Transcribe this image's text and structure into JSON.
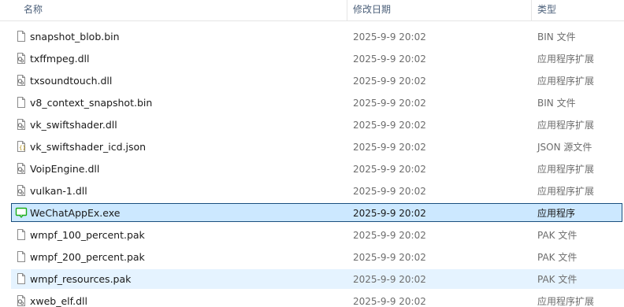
{
  "columns": {
    "name": "名称",
    "date": "修改日期",
    "type": "类型"
  },
  "files": [
    {
      "name": "snapshot_blob.bin",
      "date": "2025-9-9 20:02",
      "type": "BIN 文件",
      "icon": "file-icon",
      "state": ""
    },
    {
      "name": "txffmpeg.dll",
      "date": "2025-9-9 20:02",
      "type": "应用程序扩展",
      "icon": "dll-icon",
      "state": ""
    },
    {
      "name": "txsoundtouch.dll",
      "date": "2025-9-9 20:02",
      "type": "应用程序扩展",
      "icon": "dll-icon",
      "state": ""
    },
    {
      "name": "v8_context_snapshot.bin",
      "date": "2025-9-9 20:02",
      "type": "BIN 文件",
      "icon": "file-icon",
      "state": ""
    },
    {
      "name": "vk_swiftshader.dll",
      "date": "2025-9-9 20:02",
      "type": "应用程序扩展",
      "icon": "dll-icon",
      "state": ""
    },
    {
      "name": "vk_swiftshader_icd.json",
      "date": "2025-9-9 20:02",
      "type": "JSON 源文件",
      "icon": "json-icon",
      "state": ""
    },
    {
      "name": "VoipEngine.dll",
      "date": "2025-9-9 20:02",
      "type": "应用程序扩展",
      "icon": "dll-icon",
      "state": ""
    },
    {
      "name": "vulkan-1.dll",
      "date": "2025-9-9 20:02",
      "type": "应用程序扩展",
      "icon": "dll-icon",
      "state": ""
    },
    {
      "name": "WeChatAppEx.exe",
      "date": "2025-9-9 20:02",
      "type": "应用程序",
      "icon": "wechat-app-icon",
      "state": "selected"
    },
    {
      "name": "wmpf_100_percent.pak",
      "date": "2025-9-9 20:02",
      "type": "PAK 文件",
      "icon": "file-icon",
      "state": ""
    },
    {
      "name": "wmpf_200_percent.pak",
      "date": "2025-9-9 20:02",
      "type": "PAK 文件",
      "icon": "file-icon",
      "state": ""
    },
    {
      "name": "wmpf_resources.pak",
      "date": "2025-9-9 20:02",
      "type": "PAK 文件",
      "icon": "file-icon",
      "state": "hover"
    },
    {
      "name": "xweb_elf.dll",
      "date": "2025-9-9 20:02",
      "type": "应用程序扩展",
      "icon": "dll-icon",
      "state": ""
    }
  ],
  "colors": {
    "selection_fill": "#cce8ff",
    "selection_border": "#1b4f7e",
    "hover_fill": "#e5f3ff",
    "header_text": "#4c607a",
    "secondary_text": "#6d6d6d"
  }
}
